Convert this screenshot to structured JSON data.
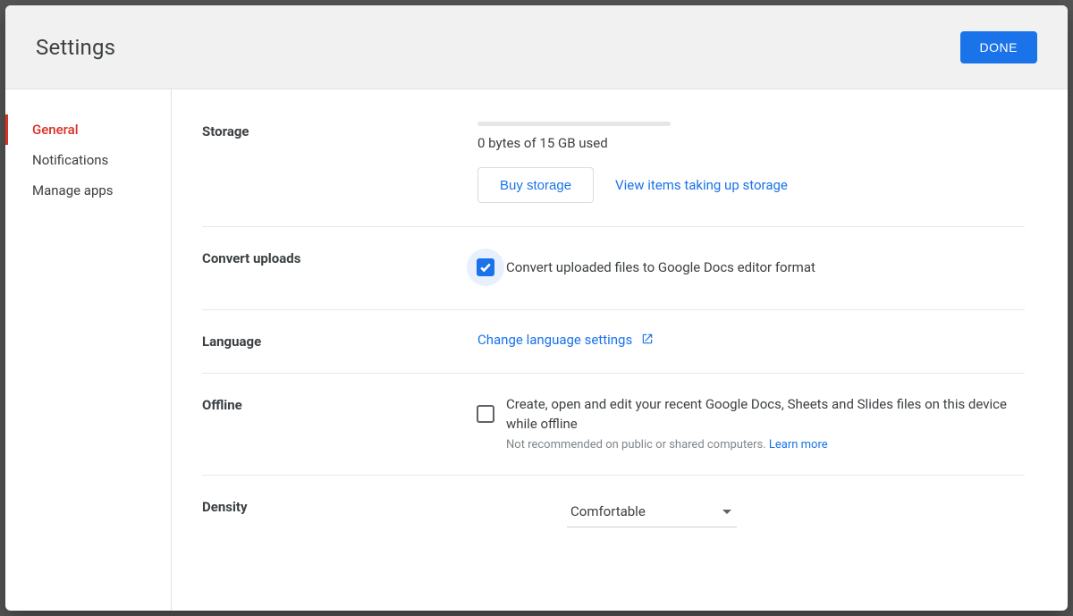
{
  "header": {
    "title": "Settings",
    "done_label": "DONE"
  },
  "sidebar": {
    "items": [
      {
        "label": "General",
        "active": true
      },
      {
        "label": "Notifications",
        "active": false
      },
      {
        "label": "Manage apps",
        "active": false
      }
    ]
  },
  "storage": {
    "section_label": "Storage",
    "usage_text": "0 bytes of 15 GB used",
    "buy_label": "Buy storage",
    "view_items_label": "View items taking up storage"
  },
  "convert": {
    "section_label": "Convert uploads",
    "checkbox_checked": true,
    "checkbox_label": "Convert uploaded files to Google Docs editor format"
  },
  "language": {
    "section_label": "Language",
    "link_label": "Change language settings"
  },
  "offline": {
    "section_label": "Offline",
    "checkbox_checked": false,
    "checkbox_label": "Create, open and edit your recent Google Docs, Sheets and Slides files on this device while offline",
    "hint": "Not recommended on public or shared computers. ",
    "learn_more": "Learn more"
  },
  "density": {
    "section_label": "Density",
    "selected": "Comfortable"
  }
}
